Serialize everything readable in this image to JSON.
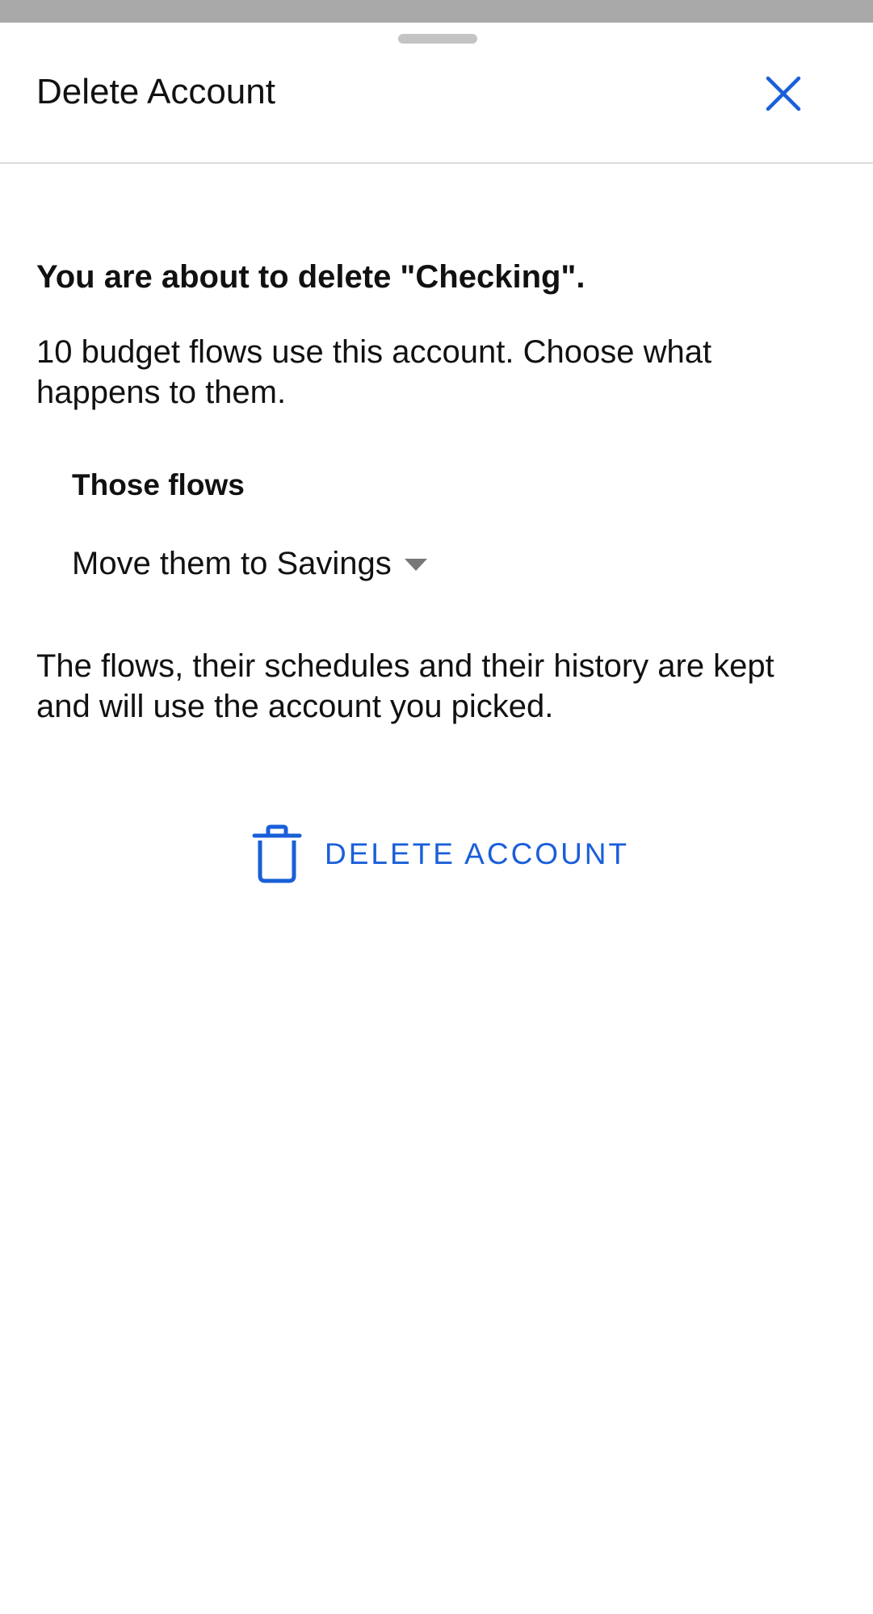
{
  "theme": {
    "accent": "#1a5fd9",
    "text": "#111111",
    "backdrop": "#a9a9a9",
    "divider": "#dcdcdc"
  },
  "sheet": {
    "title": "Delete Account",
    "close_icon": "close-icon"
  },
  "body": {
    "heading": "You are about to delete \"Checking\".",
    "description": "10 budget flows use this account. Choose what happens to them.",
    "flows_label": "Those flows",
    "flows_select": {
      "selected": "Move them to Savings"
    },
    "note": "The flows, their schedules and their history are kept and will use the account you picked."
  },
  "actions": {
    "delete_label": "DELETE ACCOUNT",
    "delete_icon": "trash-icon"
  }
}
